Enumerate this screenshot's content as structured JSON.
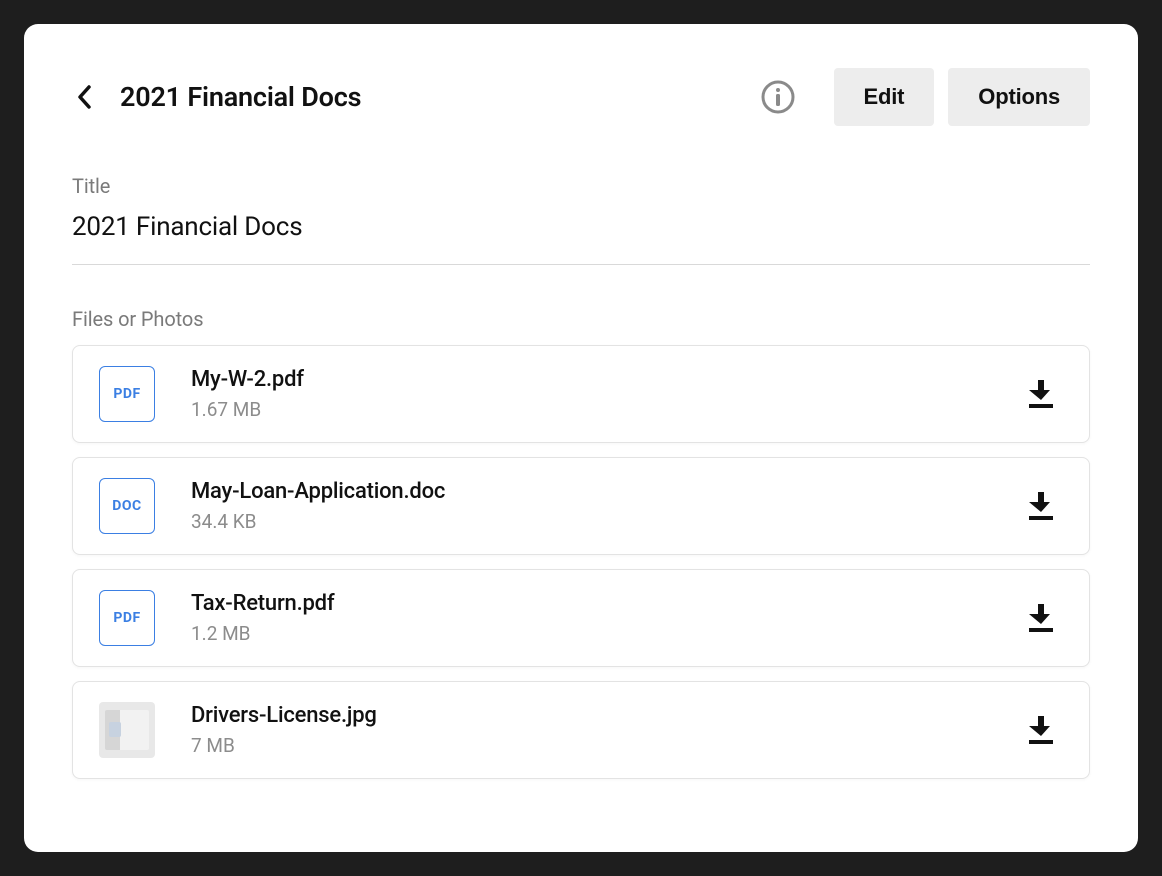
{
  "header": {
    "title": "2021 Financial Docs",
    "edit_label": "Edit",
    "options_label": "Options"
  },
  "title_section": {
    "label": "Title",
    "value": "2021 Financial Docs"
  },
  "files_section": {
    "label": "Files or Photos",
    "items": [
      {
        "name": "My-W-2.pdf",
        "size": "1.67 MB",
        "badge": "PDF",
        "kind": "doc"
      },
      {
        "name": "May-Loan-Application.doc",
        "size": "34.4 KB",
        "badge": "DOC",
        "kind": "doc"
      },
      {
        "name": "Tax-Return.pdf",
        "size": "1.2 MB",
        "badge": "PDF",
        "kind": "doc"
      },
      {
        "name": "Drivers-License.jpg",
        "size": "7 MB",
        "badge": "",
        "kind": "image"
      }
    ]
  }
}
